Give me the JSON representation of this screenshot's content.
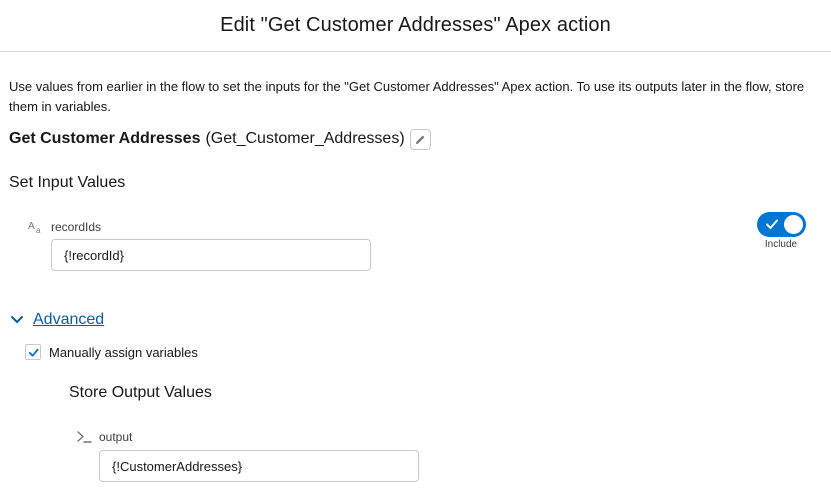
{
  "header": {
    "title": "Edit \"Get Customer Addresses\" Apex action"
  },
  "intro": {
    "text": "Use values from earlier in the flow to set the inputs for the \"Get Customer Addresses\" Apex action. To use its outputs later in the flow, store them in variables."
  },
  "action": {
    "label": "Get Customer Addresses",
    "api_name": "(Get_Customer_Addresses)",
    "edit_icon": "pencil-icon"
  },
  "inputs": {
    "section_title": "Set Input Values",
    "params": [
      {
        "type_icon": "text-type-icon",
        "label": "recordIds",
        "value": "{!recordId}",
        "include": true,
        "include_label": "Include"
      }
    ]
  },
  "advanced": {
    "label": "Advanced",
    "expanded": true,
    "manual_assign": {
      "checked": true,
      "label": "Manually assign variables"
    }
  },
  "outputs": {
    "section_title": "Store Output Values",
    "params": [
      {
        "type_icon": "prompt-icon",
        "label": "output",
        "value": "{!CustomerAddresses}"
      }
    ]
  },
  "colors": {
    "accent": "#0176d3",
    "link": "#0b5cab",
    "border": "#c9c9c9",
    "text": "#181818"
  }
}
